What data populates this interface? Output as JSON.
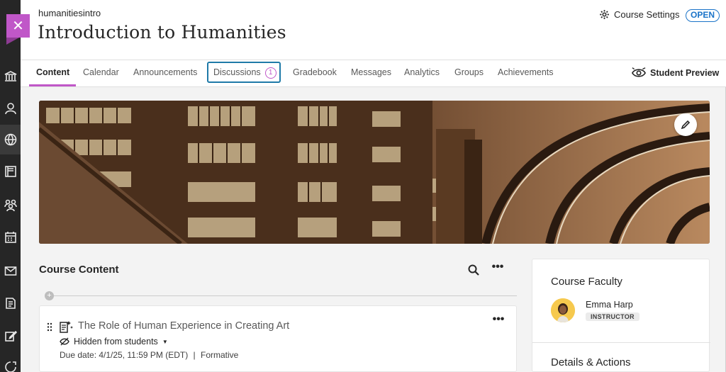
{
  "header": {
    "course_id": "humanitiesintro",
    "course_title": "Introduction to Humanities",
    "settings_label": "Course Settings",
    "status_badge": "OPEN"
  },
  "tabs": [
    {
      "label": "Content"
    },
    {
      "label": "Calendar"
    },
    {
      "label": "Announcements"
    },
    {
      "label": "Discussions",
      "count": "1"
    },
    {
      "label": "Gradebook"
    },
    {
      "label": "Messages"
    },
    {
      "label": "Analytics"
    },
    {
      "label": "Groups"
    },
    {
      "label": "Achievements"
    }
  ],
  "student_preview_label": "Student Preview",
  "course_content": {
    "title": "Course Content",
    "item": {
      "title": "The Role of Human Experience in Creating Art",
      "visibility": "Hidden from students",
      "due": "Due date: 4/1/25, 11:59 PM (EDT)",
      "category": "Formative"
    }
  },
  "faculty": {
    "title": "Course Faculty",
    "name": "Emma Harp",
    "role": "INSTRUCTOR"
  },
  "details_title": "Details & Actions",
  "colors": {
    "accent": "#c057c8",
    "open_badge": "#1a73c8",
    "focus_ring": "#1f7aa8"
  },
  "icons": [
    "close-icon",
    "gear-icon",
    "eye-icon",
    "pencil-icon",
    "search-icon",
    "more-icon",
    "hidden-eye-icon",
    "drag-handle-icon",
    "assignment-icon",
    "institution-icon",
    "person-icon",
    "globe-icon",
    "courses-icon",
    "groups-icon",
    "calendar-icon",
    "mail-icon",
    "grades-icon",
    "edit-icon",
    "signout-icon"
  ]
}
